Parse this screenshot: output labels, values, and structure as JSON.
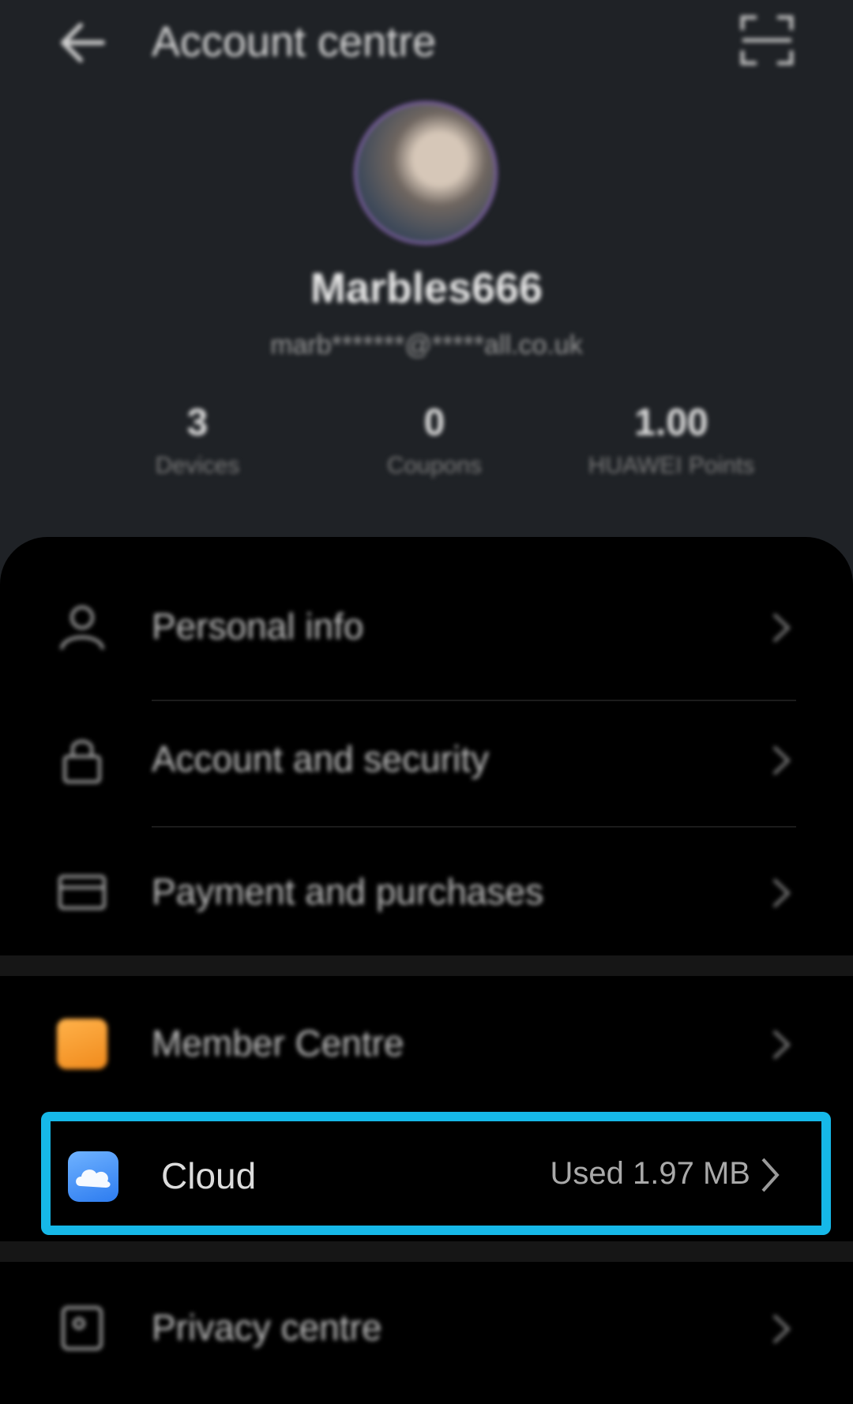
{
  "header": {
    "title": "Account centre"
  },
  "profile": {
    "username": "Marbles666",
    "email": "marb*******@*****all.co.uk",
    "stats": [
      {
        "value": "3",
        "label": "Devices"
      },
      {
        "value": "0",
        "label": "Coupons"
      },
      {
        "value": "1.00",
        "label": "HUAWEI Points"
      }
    ]
  },
  "menu": {
    "items": [
      {
        "label": "Personal info",
        "icon": "person-icon"
      },
      {
        "label": "Account and security",
        "icon": "lock-icon"
      },
      {
        "label": "Payment and purchases",
        "icon": "card-icon"
      },
      {
        "label": "Member Centre",
        "icon": "member-icon"
      },
      {
        "label": "Cloud",
        "icon": "cloud-icon",
        "value": "Used 1.97 MB"
      },
      {
        "label": "Privacy centre",
        "icon": "privacy-icon"
      }
    ]
  },
  "colors": {
    "highlight": "#16b8e8",
    "background": "#1f2226",
    "card": "#000000"
  }
}
